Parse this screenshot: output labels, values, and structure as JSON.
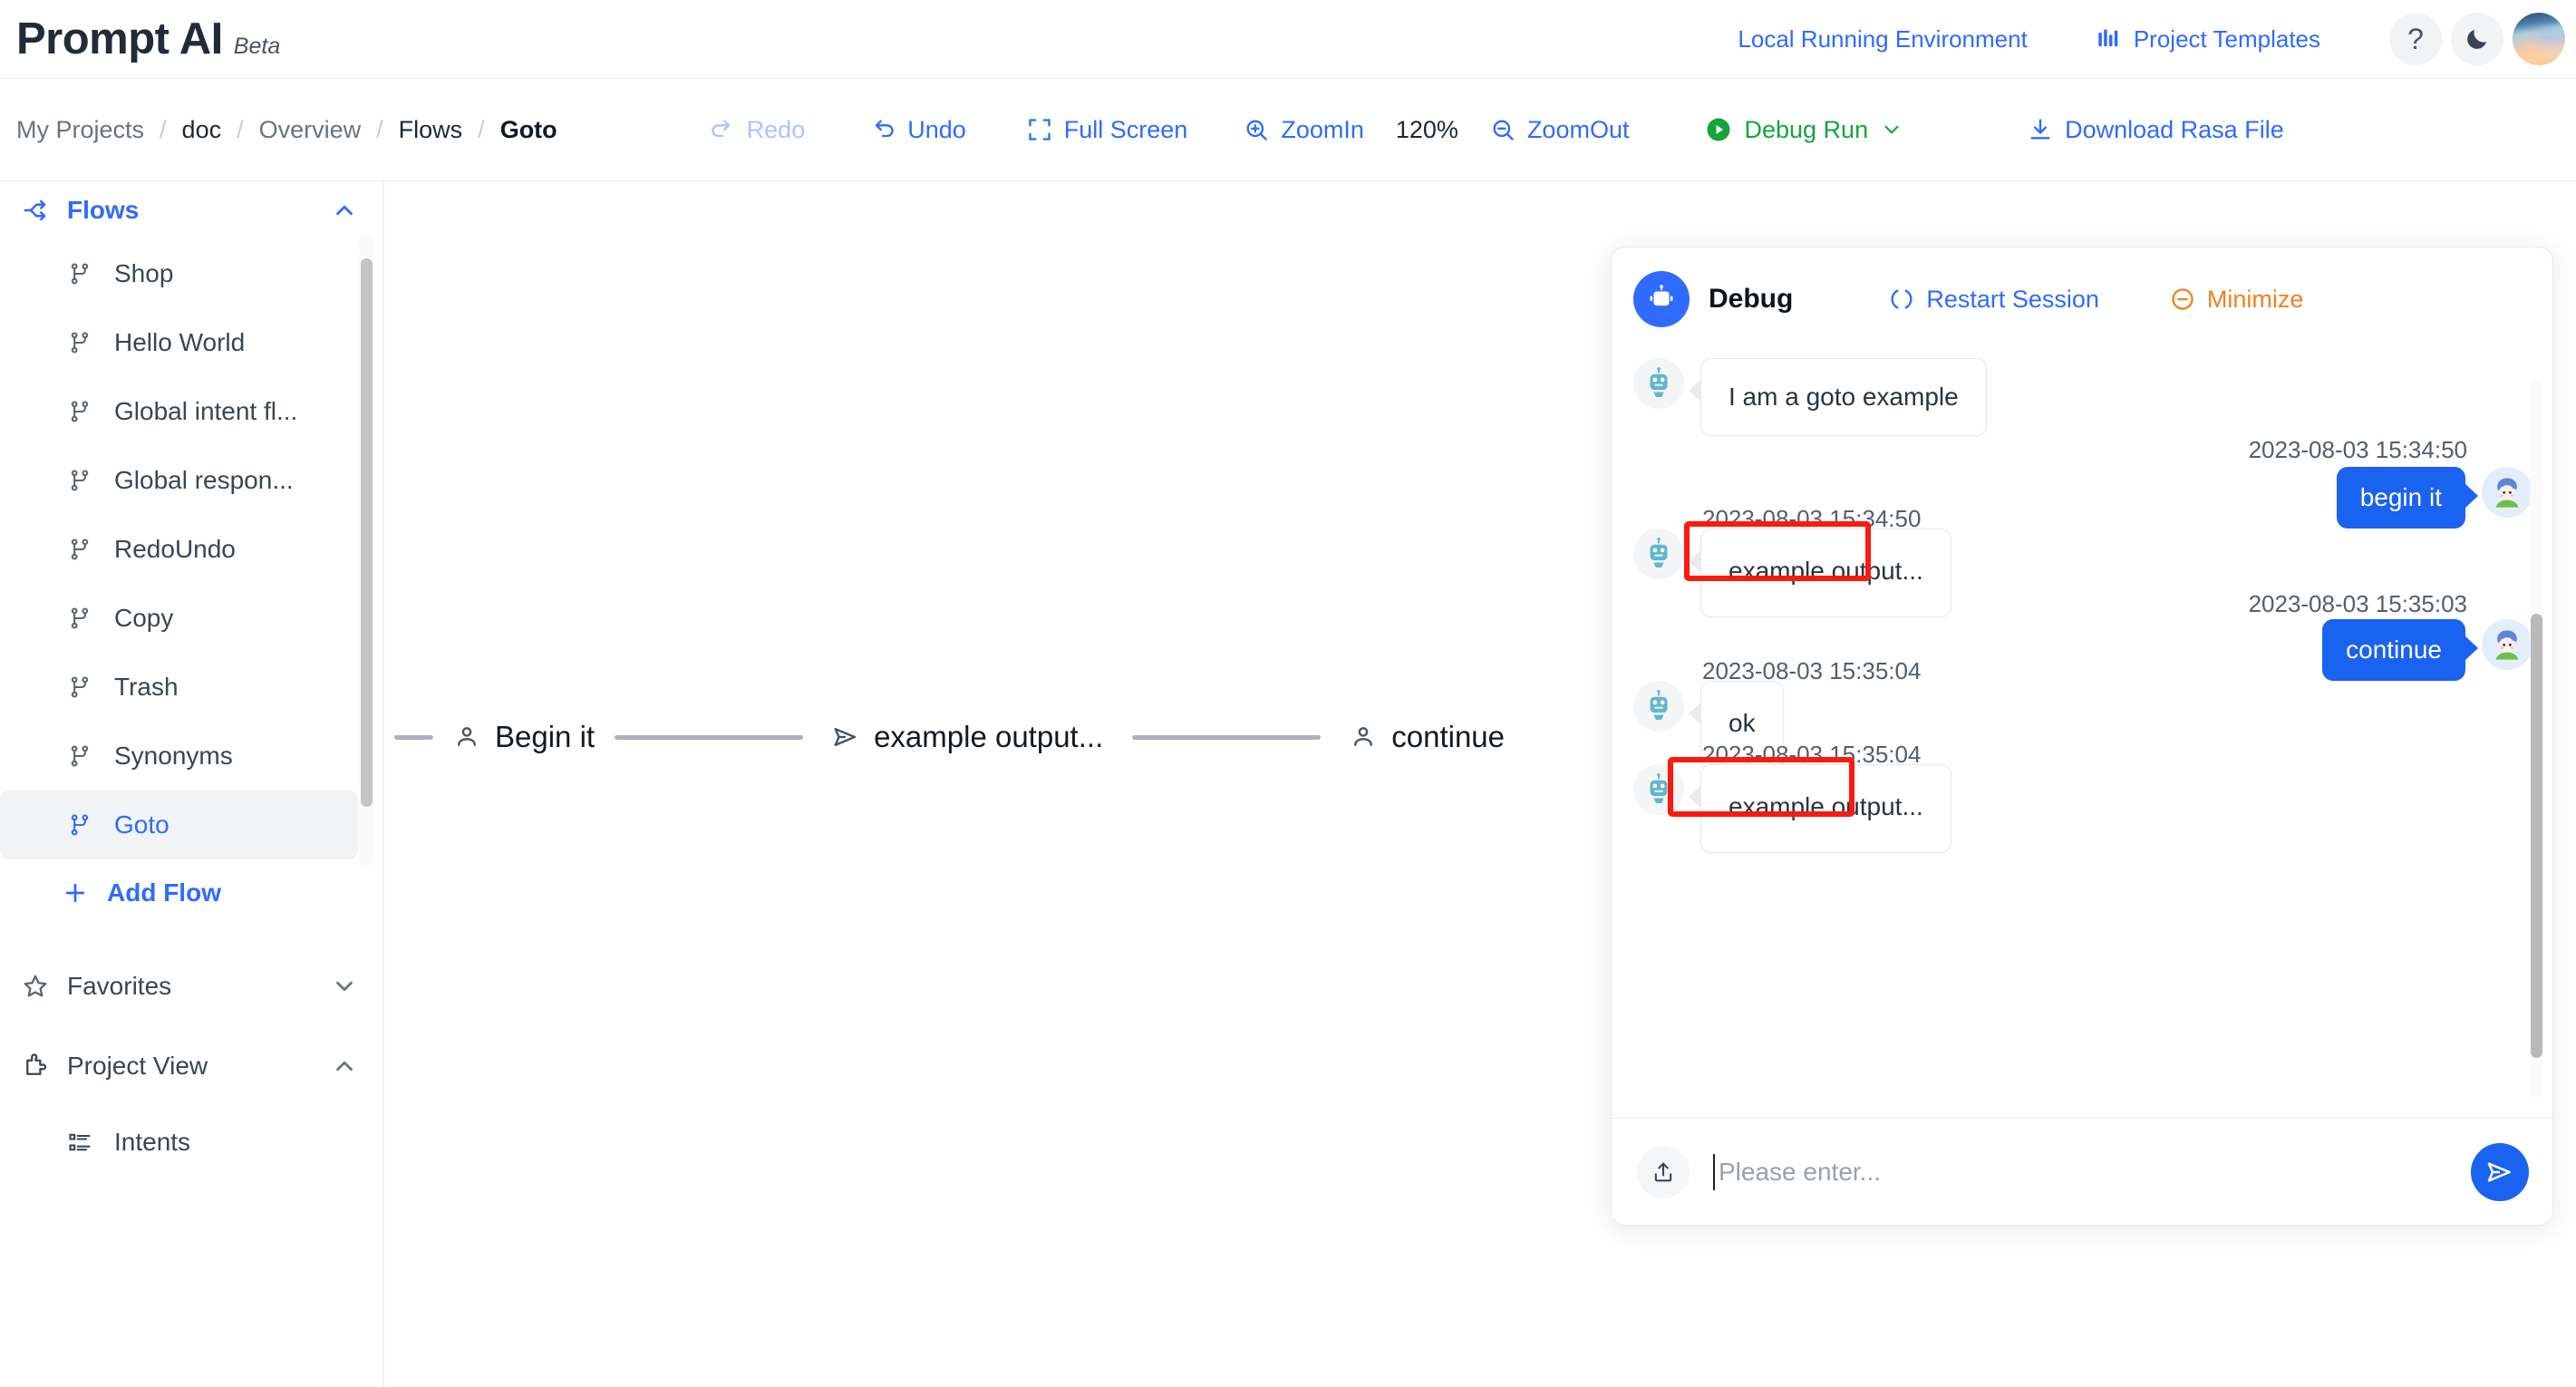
{
  "header": {
    "logo_title": "Prompt AI",
    "logo_beta": "Beta",
    "env_link": "Local Running Environment",
    "templates_link": "Project Templates",
    "help_glyph": "?",
    "icons": {
      "templates": "bar-chart-icon",
      "help": "question-mark-icon",
      "dark_mode": "moon-icon",
      "avatar": "user-avatar"
    }
  },
  "breadcrumb": {
    "items": [
      {
        "label": "My Projects",
        "state": "muted"
      },
      {
        "label": "doc",
        "state": "dark"
      },
      {
        "label": "Overview",
        "state": "muted"
      },
      {
        "label": "Flows",
        "state": "dark"
      },
      {
        "label": "Goto",
        "state": "active"
      }
    ],
    "separator": "/"
  },
  "toolbar": {
    "redo": "Redo",
    "undo": "Undo",
    "full_screen": "Full Screen",
    "zoom_in": "ZoomIn",
    "zoom_level": "120%",
    "zoom_out": "ZoomOut",
    "debug_run": "Debug Run",
    "download": "Download Rasa File"
  },
  "sidebar": {
    "flows_section": "Flows",
    "flows": [
      {
        "label": "Shop"
      },
      {
        "label": "Hello World"
      },
      {
        "label": "Global intent fl..."
      },
      {
        "label": "Global respon..."
      },
      {
        "label": "RedoUndo"
      },
      {
        "label": "Copy"
      },
      {
        "label": "Trash"
      },
      {
        "label": "Synonyms"
      },
      {
        "label": "Goto"
      }
    ],
    "selected_flow": "Goto",
    "add_flow": "Add Flow",
    "favorites": "Favorites",
    "project_view": "Project View",
    "intents": "Intents"
  },
  "canvas": {
    "nodes": [
      {
        "label": "Begin it",
        "icon": "user-icon"
      },
      {
        "label": "example output...",
        "icon": "send-icon"
      },
      {
        "label": "continue",
        "icon": "user-icon"
      }
    ]
  },
  "debug": {
    "title": "Debug",
    "restart": "Restart Session",
    "minimize": "Minimize",
    "messages": [
      {
        "side": "bot",
        "text": "I am a goto example",
        "timestamp": "",
        "highlighted": false
      },
      {
        "side": "user",
        "text": "begin it",
        "timestamp": "2023-08-03 15:34:50",
        "highlighted": false
      },
      {
        "side": "bot",
        "text": "example output...",
        "timestamp": "2023-08-03 15:34:50",
        "highlighted": true
      },
      {
        "side": "user",
        "text": "continue",
        "timestamp": "2023-08-03 15:35:03",
        "highlighted": false
      },
      {
        "side": "bot",
        "text": "ok",
        "timestamp": "2023-08-03 15:35:04",
        "highlighted": false
      },
      {
        "side": "bot",
        "text": "example output...",
        "timestamp": "2023-08-03 15:35:04",
        "highlighted": true
      }
    ],
    "input_placeholder": "Please enter...",
    "input_value": ""
  },
  "colors": {
    "accent_blue": "#2f6bff",
    "debug_green": "#13a53a",
    "minimize_orange": "#f0821e",
    "highlight_red": "#fb1a0e",
    "user_bubble": "#1a62f0"
  }
}
